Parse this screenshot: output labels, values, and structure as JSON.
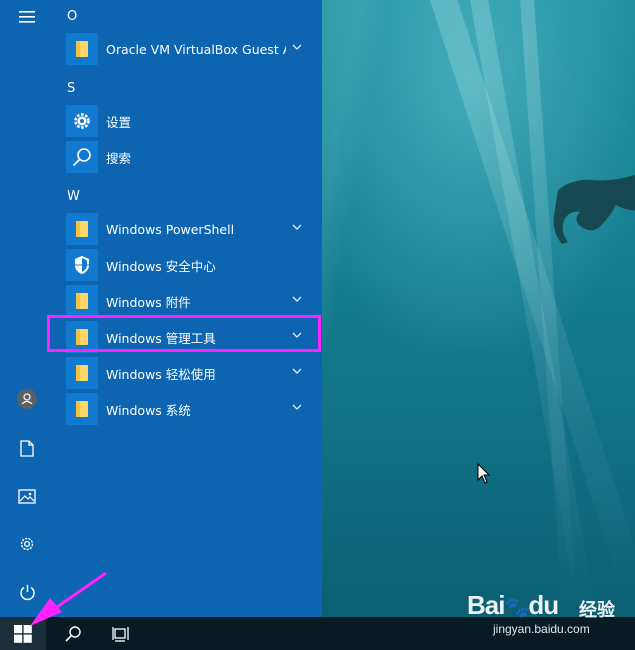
{
  "start_menu": {
    "sections": [
      {
        "letter": "O",
        "apps": [
          {
            "label": "Oracle VM VirtualBox Guest A...",
            "icon": "folder-icon",
            "expandable": true
          }
        ]
      },
      {
        "letter": "S",
        "apps": [
          {
            "label": "设置",
            "icon": "gear-icon",
            "expandable": false
          },
          {
            "label": "搜索",
            "icon": "search-icon",
            "expandable": false
          }
        ]
      },
      {
        "letter": "W",
        "apps": [
          {
            "label": "Windows PowerShell",
            "icon": "folder-icon",
            "expandable": true
          },
          {
            "label": "Windows 安全中心",
            "icon": "shield-icon",
            "expandable": false
          },
          {
            "label": "Windows 附件",
            "icon": "folder-icon",
            "expandable": true
          },
          {
            "label": "Windows 管理工具",
            "icon": "folder-icon",
            "expandable": true,
            "highlighted": true
          },
          {
            "label": "Windows 轻松使用",
            "icon": "folder-icon",
            "expandable": true
          },
          {
            "label": "Windows 系统",
            "icon": "folder-icon",
            "expandable": true
          }
        ]
      }
    ],
    "rail": [
      "menu-icon",
      "user-icon",
      "document-icon",
      "pictures-icon",
      "settings-icon",
      "power-icon"
    ]
  },
  "taskbar": {
    "buttons": [
      "windows-start-icon",
      "search-icon",
      "task-view-icon"
    ]
  },
  "watermark": {
    "brand": "Bai",
    "brand_suffix": "du",
    "sub": "经验",
    "url": "jingyan.baidu.com"
  },
  "colors": {
    "menu_bg": "#0d65b1",
    "tile": "#1279d0",
    "highlight": "#ff22ff",
    "taskbar": "#081a24"
  }
}
